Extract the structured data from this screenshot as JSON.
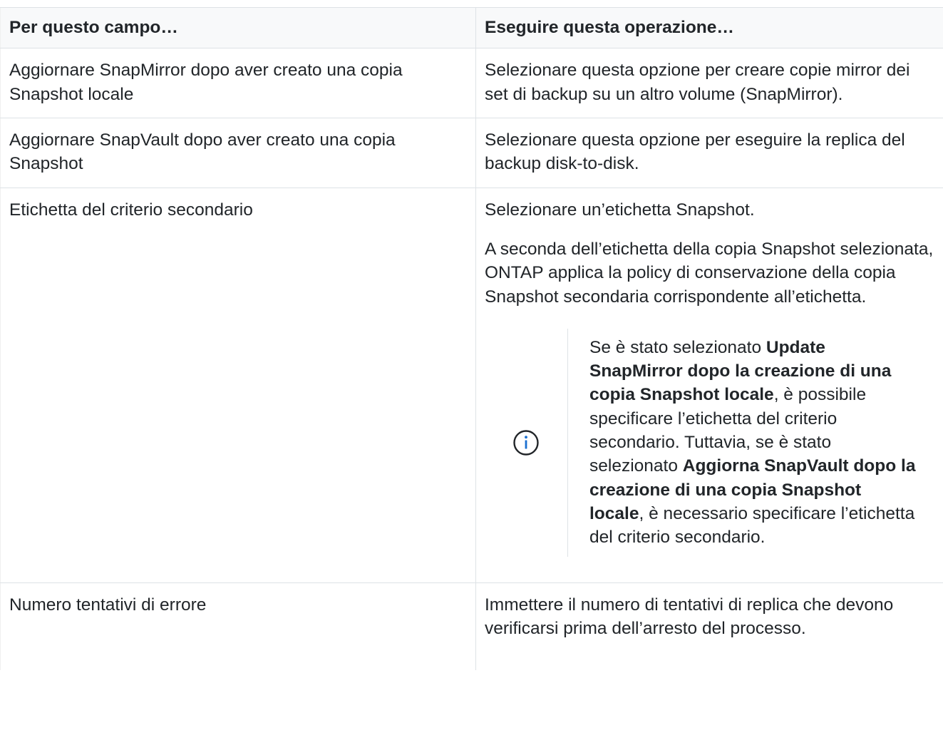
{
  "table": {
    "headers": [
      "Per questo campo…",
      "Eseguire questa operazione…"
    ],
    "rows": [
      {
        "field": "Aggiornare SnapMirror dopo aver creato una copia Snapshot locale",
        "action": "Selezionare questa opzione per creare copie mirror dei set di backup su un altro volume (SnapMirror)."
      },
      {
        "field": "Aggiornare SnapVault dopo aver creato una copia Snapshot",
        "action": "Selezionare questa opzione per eseguire la replica del backup disk-to-disk."
      },
      {
        "field": "Etichetta del criterio secondario",
        "action": "Selezionare un’etichetta Snapshot.",
        "action_para2": "A seconda dell’etichetta della copia Snapshot selezionata, ONTAP applica la policy di conservazione della copia Snapshot secondaria corrispondente all’etichetta.",
        "note": {
          "icon": "info-icon",
          "t1": "Se è stato selezionato ",
          "b1": "Update SnapMirror dopo la creazione di una copia Snapshot locale",
          "t2": ", è possibile specificare l’etichetta del criterio secondario. Tuttavia, se è stato selezionato ",
          "b2": "Aggiorna SnapVault dopo la creazione di una copia Snapshot locale",
          "t3": ", è necessario specificare l’etichetta del criterio secondario."
        }
      },
      {
        "field": "Numero tentativi di errore",
        "action": "Immettere il numero di tentativi di replica che devono verificarsi prima dell’arresto del processo."
      }
    ]
  },
  "colors": {
    "text": "#212529",
    "border": "#dee2e6",
    "header_bg": "#f8f9fa"
  }
}
